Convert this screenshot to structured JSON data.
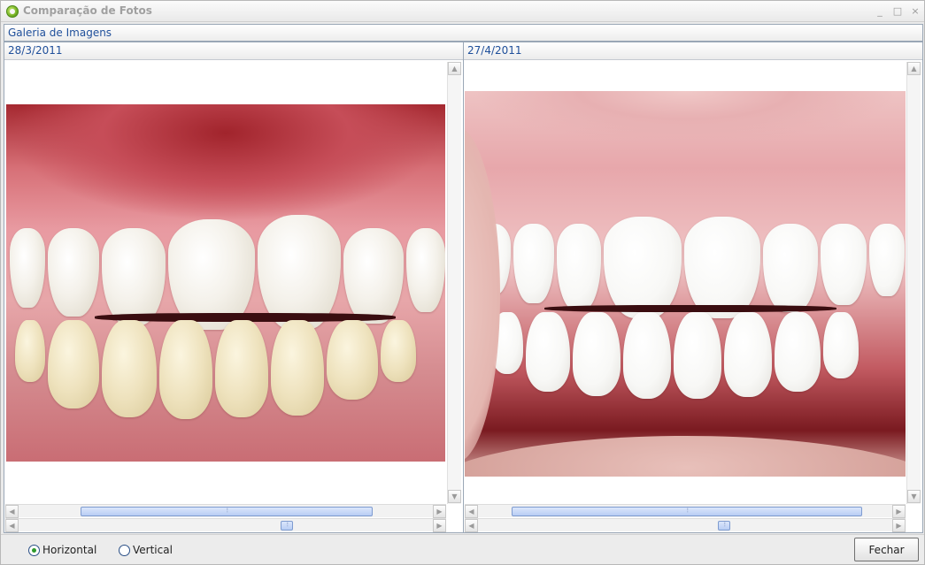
{
  "window": {
    "title": "Comparação de Fotos",
    "controls": {
      "minimize": "_",
      "maximize": "□",
      "close": "×"
    }
  },
  "gallery": {
    "label": "Galeria de Imagens"
  },
  "panes": [
    {
      "date": "28/3/2011",
      "photo": "teeth-before"
    },
    {
      "date": "27/4/2011",
      "photo": "teeth-after"
    }
  ],
  "scroll_glyphs": {
    "up": "▲",
    "down": "▼",
    "left": "◀",
    "right": "▶"
  },
  "orientation": {
    "options": [
      {
        "label": "Horizontal",
        "selected": true
      },
      {
        "label": "Vertical",
        "selected": false
      }
    ]
  },
  "footer": {
    "close_label": "Fechar"
  },
  "colors": {
    "header_text": "#1f4f9a",
    "accent": "#7cb82a"
  }
}
